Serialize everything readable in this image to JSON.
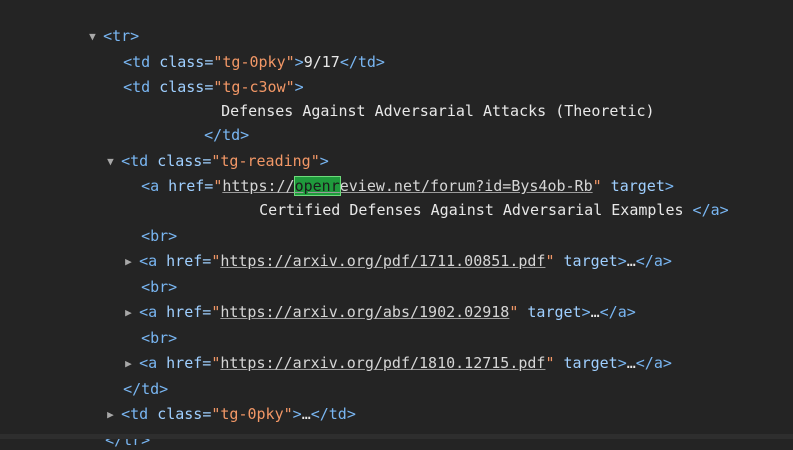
{
  "lines": {
    "l1": {
      "lt": "<",
      "tag": "tr",
      "gt": ">"
    },
    "l2": {
      "open": "<td ",
      "attr": "class=",
      "q1": "\"",
      "val": "tg-0pky",
      "q2": "\"",
      "close": ">",
      "text": "9/17",
      "end": "</td>"
    },
    "l3": {
      "open": "<td ",
      "attr": "class=",
      "q1": "\"",
      "val": "tg-c3ow",
      "q2": "\"",
      "close": ">"
    },
    "l4": {
      "text": "Defenses Against Adversarial Attacks (Theoretic)"
    },
    "l5": {
      "end": "</td>"
    },
    "l6": {
      "open": "<td ",
      "attr": "class=",
      "q1": "\"",
      "val": "tg-reading",
      "q2": "\"",
      "close": ">"
    },
    "l7": {
      "open": "<a ",
      "attr": "href=",
      "q1": "\"",
      "link_a": "https://",
      "link_hl": "openr",
      "link_b": "eview.net/forum?id=Bys4ob-Rb",
      "q2": "\"",
      "target": " target",
      "close": ">"
    },
    "l8": {
      "text": "Certified Defenses Against Adversarial Examples ",
      "end": "</a>"
    },
    "l9": {
      "tag": "<br>"
    },
    "l10": {
      "open": "<a ",
      "attr": "href=",
      "q1": "\"",
      "link": "https://arxiv.org/pdf/1711.00851.pdf",
      "q2": "\"",
      "target": " target",
      "close": ">",
      "ellipsis": "…",
      "end": "</a>"
    },
    "l11": {
      "tag": "<br>"
    },
    "l12": {
      "open": "<a ",
      "attr": "href=",
      "q1": "\"",
      "link": "https://arxiv.org/abs/1902.02918",
      "q2": "\"",
      "target": " target",
      "close": ">",
      "ellipsis": "…",
      "end": "</a>"
    },
    "l13": {
      "tag": "<br>"
    },
    "l14": {
      "open": "<a ",
      "attr": "href=",
      "q1": "\"",
      "link": "https://arxiv.org/pdf/1810.12715.pdf",
      "q2": "\"",
      "target": " target",
      "close": ">",
      "ellipsis": "…",
      "end": "</a>"
    },
    "l15": {
      "end": "</td>"
    },
    "l16": {
      "open": "<td ",
      "attr": "class=",
      "q1": "\"",
      "val": "tg-0pky",
      "q2": "\"",
      "close": ">",
      "ellipsis": "…",
      "end": "</td>"
    },
    "l17": {
      "end": "</tr>"
    }
  },
  "icons": {
    "expanded": "▼",
    "collapsed": "▶"
  }
}
